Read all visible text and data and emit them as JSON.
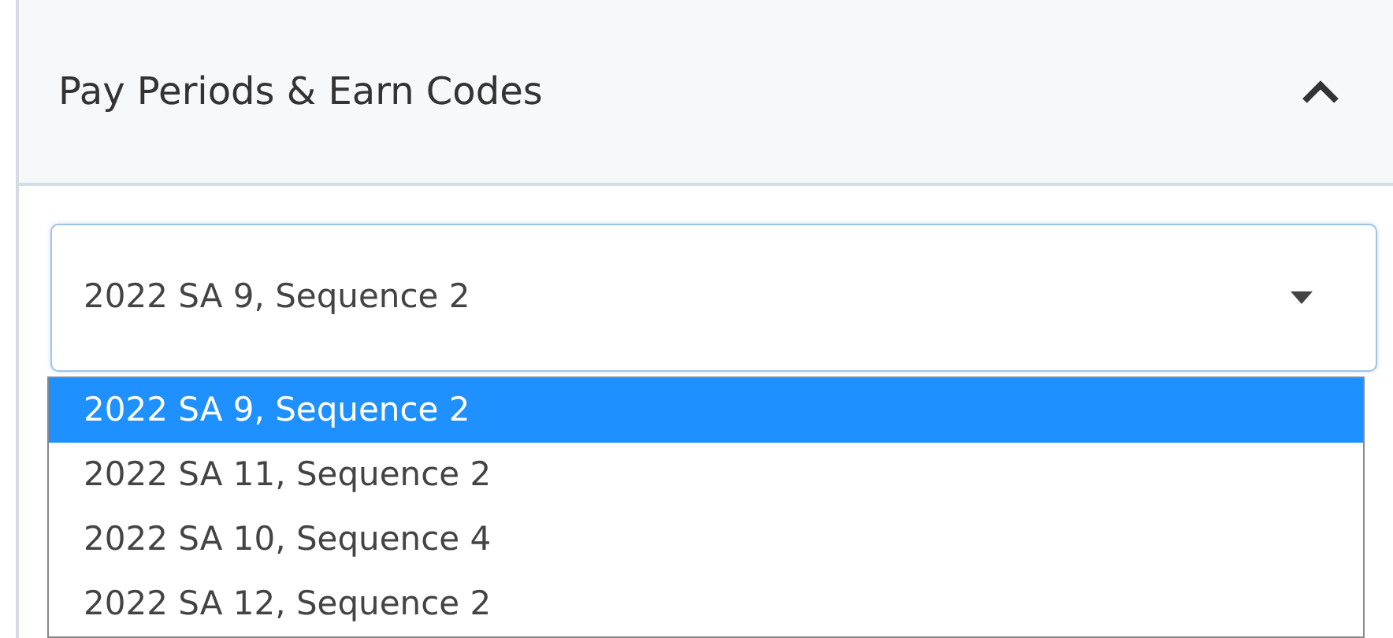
{
  "panel": {
    "title": "Pay Periods & Earn Codes",
    "expanded": true
  },
  "select": {
    "value": "2022 SA 9, Sequence 2",
    "open": true
  },
  "options": [
    {
      "label": "2022 SA 9, Sequence 2",
      "selected": true
    },
    {
      "label": "2022 SA 11, Sequence 2",
      "selected": false
    },
    {
      "label": "2022 SA 10, Sequence 4",
      "selected": false
    },
    {
      "label": "2022 SA 12, Sequence 2",
      "selected": false
    }
  ]
}
